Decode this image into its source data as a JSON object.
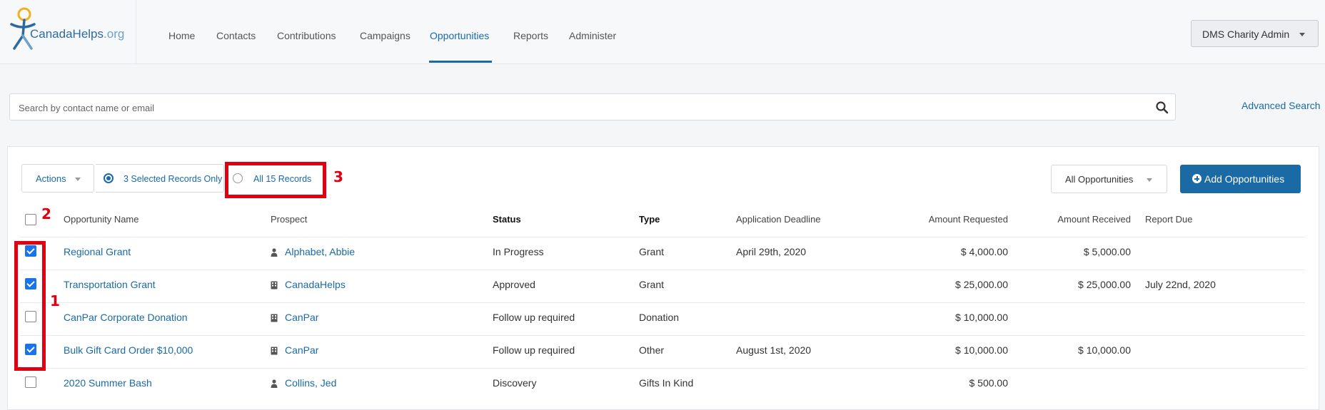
{
  "brand": {
    "name_main": "CanadaHelps",
    "name_suffix": ".org"
  },
  "nav": [
    {
      "label": "Home",
      "active": false
    },
    {
      "label": "Contacts",
      "active": false
    },
    {
      "label": "Contributions",
      "active": false
    },
    {
      "label": "Campaigns",
      "active": false
    },
    {
      "label": "Opportunities",
      "active": true
    },
    {
      "label": "Reports",
      "active": false
    },
    {
      "label": "Administer",
      "active": false
    }
  ],
  "user": {
    "label": "DMS Charity Admin"
  },
  "search": {
    "placeholder": "Search by contact name or email",
    "icon": "search-icon"
  },
  "advanced_search": "Advanced Search",
  "toolbar": {
    "actions_label": "Actions",
    "selected_only_label": "3 Selected Records Only",
    "all_records_label": "All 15 Records",
    "filter_label": "All Opportunities",
    "add_label": "Add Opportunities"
  },
  "annotations": [
    "1",
    "2",
    "3"
  ],
  "columns": [
    "Opportunity Name",
    "Prospect",
    "Status",
    "Type",
    "Application Deadline",
    "Amount Requested",
    "Amount Received",
    "Report Due"
  ],
  "rows": [
    {
      "checked": true,
      "name": "Regional Grant",
      "prospect": "Alphabet, Abbie",
      "prospect_icon": "person-icon",
      "status": "In Progress",
      "type": "Grant",
      "deadline": "April 29th, 2020",
      "requested": "$ 4,000.00",
      "received": "$ 5,000.00",
      "report_due": ""
    },
    {
      "checked": true,
      "name": "Transportation Grant",
      "prospect": "CanadaHelps",
      "prospect_icon": "building-icon",
      "status": "Approved",
      "type": "Grant",
      "deadline": "",
      "requested": "$ 25,000.00",
      "received": "$ 25,000.00",
      "report_due": "July 22nd, 2020"
    },
    {
      "checked": false,
      "name": "CanPar Corporate Donation",
      "prospect": "CanPar",
      "prospect_icon": "building-icon",
      "status": "Follow up required",
      "type": "Donation",
      "deadline": "",
      "requested": "$ 10,000.00",
      "received": "",
      "report_due": ""
    },
    {
      "checked": true,
      "name": "Bulk Gift Card Order $10,000",
      "prospect": "CanPar",
      "prospect_icon": "building-icon",
      "status": "Follow up required",
      "type": "Other",
      "deadline": "August 1st, 2020",
      "requested": "$ 10,000.00",
      "received": "$ 10,000.00",
      "report_due": ""
    },
    {
      "checked": false,
      "name": "2020 Summer Bash",
      "prospect": "Collins, Jed",
      "prospect_icon": "person-icon",
      "status": "Discovery",
      "type": "Gifts In Kind",
      "deadline": "",
      "requested": "$ 500.00",
      "received": "",
      "report_due": ""
    }
  ],
  "colors": {
    "accent": "#1a6aa6",
    "annotation_red": "#e0000f",
    "checkbox_blue": "#1a73e8"
  }
}
